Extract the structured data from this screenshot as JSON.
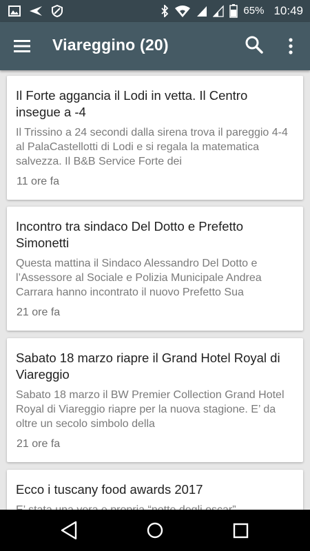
{
  "status_bar": {
    "icons_left": [
      "image-icon",
      "send-icon",
      "do-not-disturb-icon"
    ],
    "icons_right": [
      "bluetooth-icon",
      "wifi-icon",
      "signal-icon",
      "signal-icon",
      "battery-icon"
    ],
    "battery": "65%",
    "time": "10:49"
  },
  "app_bar": {
    "title": "Viareggino (20)",
    "icons": [
      "menu-icon",
      "search-icon",
      "more-vert-icon"
    ],
    "color": "#455a64"
  },
  "articles": [
    {
      "title": "Il Forte aggancia il Lodi in vetta. Il Centro insegue a -4",
      "snippet": "Il Trissino a 24 secondi dalla sirena trova il pareggio 4-4 al PalaCastellotti di Lodi e si regala la matematica salvezza. Il B&B Service Forte dei",
      "time": "11 ore fa"
    },
    {
      "title": "Incontro tra sindaco Del Dotto e Prefetto Simonetti",
      "snippet": "Questa mattina il Sindaco Alessandro Del Dotto e l’Assessore al Sociale e Polizia Municipale Andrea Carrara hanno incontrato il nuovo Prefetto Sua",
      "time": "21 ore fa"
    },
    {
      "title": "Sabato 18 marzo riapre il Grand Hotel Royal di Viareggio",
      "snippet": "Sabato 18 marzo il BW Premier Collection Grand Hotel Royal di Viareggio riapre per la nuova stagione. E’ da oltre un secolo simbolo della",
      "time": "21 ore fa"
    },
    {
      "title": "Ecco i tuscany  food awards 2017",
      "snippet": "E’ stata una vera e propria “notte degli oscar”"
    }
  ],
  "nav_bar": {
    "icons": [
      "back-icon",
      "home-icon",
      "recents-icon"
    ]
  }
}
